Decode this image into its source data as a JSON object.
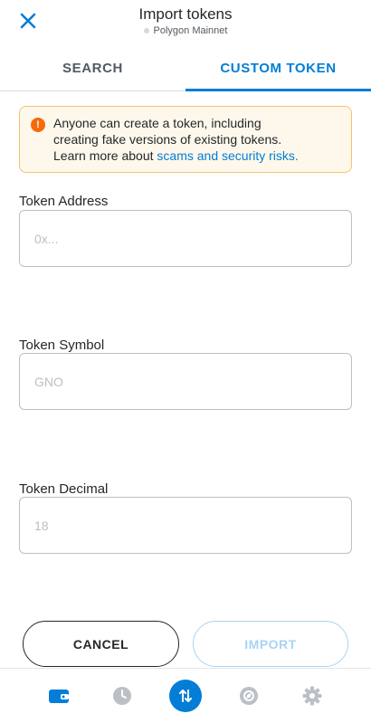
{
  "header": {
    "title": "Import tokens",
    "network": "Polygon Mainnet"
  },
  "tabs": [
    {
      "label": "SEARCH",
      "active": false
    },
    {
      "label": "CUSTOM TOKEN",
      "active": true
    }
  ],
  "warning": {
    "icon": "exclamation-icon",
    "text_line1": "Anyone can create a token, including",
    "text_line2": "creating fake versions of existing tokens.",
    "text_line3": "Learn more about ",
    "link": "scams and security risks."
  },
  "form": {
    "address": {
      "label": "Token Address",
      "placeholder": "0x...",
      "value": ""
    },
    "symbol": {
      "label": "Token Symbol",
      "placeholder": "GNO",
      "value": ""
    },
    "decimal": {
      "label": "Token Decimal",
      "placeholder": "18",
      "value": ""
    }
  },
  "buttons": {
    "cancel": "CANCEL",
    "import": "IMPORT",
    "import_disabled": true
  },
  "bottom_nav": [
    {
      "icon": "wallet-icon",
      "active": true
    },
    {
      "icon": "clock-icon",
      "active": false
    },
    {
      "icon": "swap-icon",
      "active": false
    },
    {
      "icon": "compass-icon",
      "active": false
    },
    {
      "icon": "gear-icon",
      "active": false
    }
  ],
  "colors": {
    "accent": "#037dd6",
    "warning_bg": "#fef8ec",
    "warning_border": "#f8c16a",
    "warning_icon": "#f66a0a",
    "disabled": "#a8d4f3"
  }
}
